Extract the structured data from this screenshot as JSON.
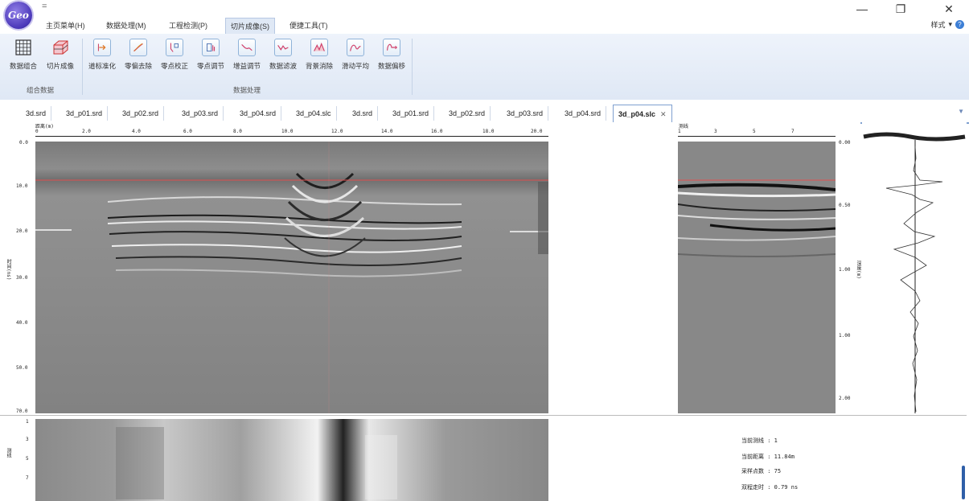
{
  "app": {
    "logo_text": "Geo",
    "quick_access": "="
  },
  "window": {
    "minimize": "—",
    "restore": "❐",
    "close": "✕"
  },
  "menu": {
    "items": [
      "主页菜单(H)",
      "数据处理(M)",
      "工程检测(P)",
      "切片成像(S)",
      "便捷工具(T)"
    ],
    "active_index": 3,
    "style_label": "样式",
    "style_arrow": "▾"
  },
  "ribbon": {
    "groups": [
      {
        "label": "组合数据",
        "buttons": [
          "数据组合",
          "切片成像"
        ]
      },
      {
        "label": "数据处理",
        "buttons": [
          "道标准化",
          "零偏去除",
          "零点校正",
          "零点调节",
          "增益调节",
          "数据滤波",
          "背景消除",
          "滑动平均",
          "数据偏移"
        ]
      }
    ]
  },
  "tabs": {
    "items": [
      "3d.srd",
      "3d_p01.srd",
      "3d_p02.srd",
      "3d_p03.srd",
      "3d_p04.srd",
      "3d_p04.slc",
      "3d.srd",
      "3d_p01.srd",
      "3d_p02.srd",
      "3d_p03.srd",
      "3d_p04.srd",
      "3d_p04.slc"
    ],
    "active_index": 11,
    "close_glyph": "✕",
    "overflow_glyph": "▼"
  },
  "main_profile": {
    "x_axis_title": "距离(m)",
    "x_ticks": [
      "0",
      "2.0",
      "4.0",
      "6.0",
      "8.0",
      "10.0",
      "12.0",
      "14.0",
      "16.0",
      "18.0",
      "20.0"
    ],
    "y_ticks": [
      "0.0",
      "10.0",
      "20.0",
      "30.0",
      "40.0",
      "50.0",
      "70.0"
    ],
    "y_axis_title": "时间(ns)"
  },
  "side_profile": {
    "x_axis_title": "测线",
    "x_ticks": [
      "1",
      "3",
      "5",
      "7"
    ],
    "y_ticks": [
      "0.00",
      "0.50",
      "0.50",
      "1.00",
      "1.00",
      "2.00"
    ],
    "y_axis_title": "深度(m)"
  },
  "slice": {
    "y_ticks": [
      "1",
      "3",
      "5",
      "7"
    ],
    "y_axis_title": "测线"
  },
  "info": {
    "line_label": "当前测线 :",
    "line_value": "1",
    "distance_label": "当前距离 :",
    "distance_value": "11.84m",
    "samples_label": "采样点数 :",
    "samples_value": "75",
    "time_label": "双程走时 :",
    "time_value": "0.79 ns"
  },
  "colors": {
    "accent": "#7fa0d0",
    "ribbon_bg": "#dfe8f5",
    "cursor_line": "#e05050"
  }
}
